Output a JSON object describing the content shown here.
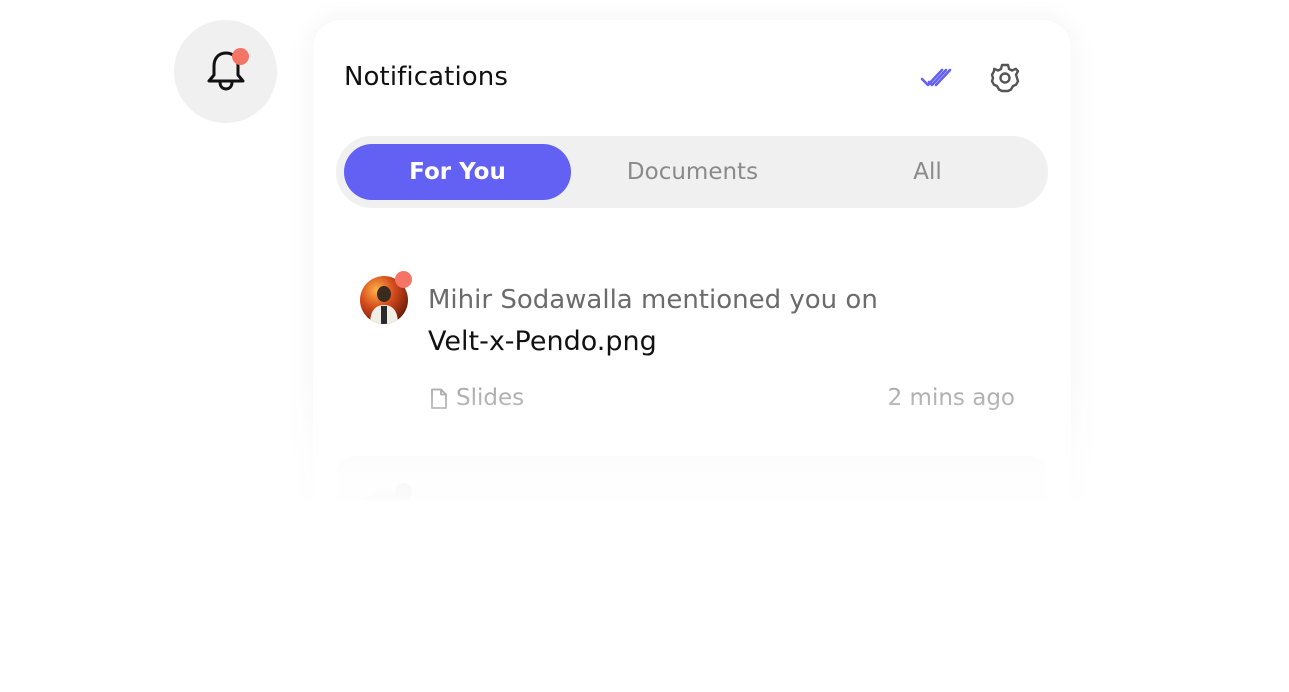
{
  "trigger": {
    "icon": "bell-icon",
    "has_unread": true,
    "badge_color": "#f47565"
  },
  "panel": {
    "title": "Notifications",
    "mark_all_read_icon": "double-check-icon",
    "settings_icon": "gear-icon",
    "accent_color": "#6360f4"
  },
  "tabs": [
    {
      "label": "For You",
      "active": true
    },
    {
      "label": "Documents",
      "active": false
    },
    {
      "label": "All",
      "active": false
    }
  ],
  "notifications": [
    {
      "avatar": "user-avatar",
      "unread": true,
      "message": "Mihir Sodawalla mentioned you on",
      "document": "Velt-x-Pendo.png",
      "source_icon": "file-icon",
      "source": "Slides",
      "time": "2 mins ago"
    }
  ]
}
